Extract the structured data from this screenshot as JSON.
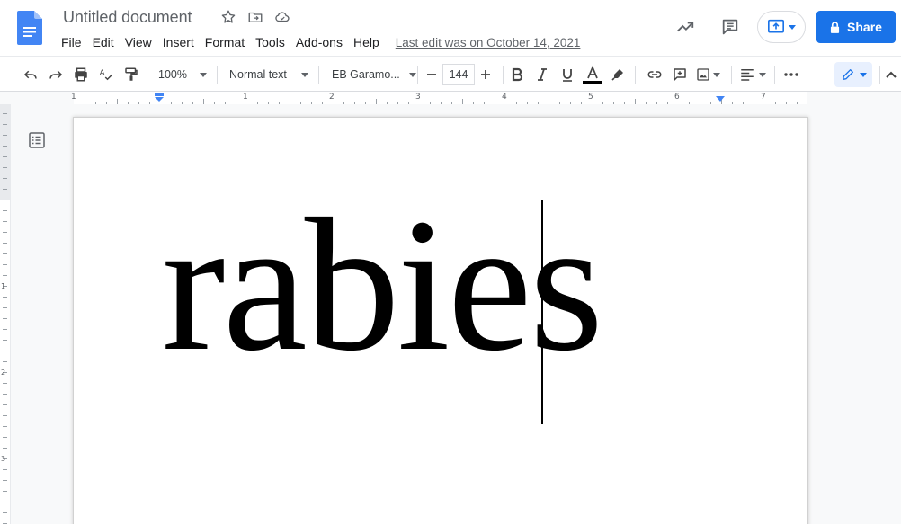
{
  "header": {
    "title": "Untitled document",
    "menus": [
      "File",
      "Edit",
      "View",
      "Insert",
      "Format",
      "Tools",
      "Add-ons",
      "Help"
    ],
    "last_edit": "Last edit was on October 14, 2021",
    "share_label": "Share"
  },
  "toolbar": {
    "zoom": "100%",
    "style": "Normal text",
    "font": "EB Garamo...",
    "font_size": "144"
  },
  "ruler": {
    "numbers": [
      "1",
      "1",
      "2",
      "3",
      "4",
      "5",
      "6",
      "7"
    ]
  },
  "vruler": {
    "numbers": [
      "1",
      "2",
      "3"
    ]
  },
  "document": {
    "body_text": "rabies"
  },
  "colors": {
    "accent": "#1a73e8",
    "docs_blue": "#4285f4"
  }
}
